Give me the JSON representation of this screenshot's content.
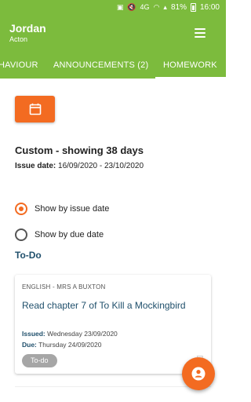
{
  "statusbar": {
    "battery": "81%",
    "time": "16:00",
    "net": "4G"
  },
  "appbar": {
    "title": "Jordan",
    "subtitle": "Acton"
  },
  "tabs": [
    {
      "label": "HAVIOUR"
    },
    {
      "label": "ANNOUNCEMENTS (2)"
    },
    {
      "label": "HOMEWORK",
      "active": true
    }
  ],
  "filter": {
    "range_title": "Custom - showing 38 days",
    "issue_label": "Issue date:",
    "issue_range": "16/09/2020 - 23/10/2020",
    "options": [
      {
        "label": "Show by issue date",
        "selected": true
      },
      {
        "label": "Show by due date",
        "selected": false
      }
    ]
  },
  "section": {
    "title": "To-Do"
  },
  "homework": [
    {
      "subject": "ENGLISH - MRS A BUXTON",
      "task": "Read chapter 7 of To Kill a Mockingbird",
      "issued_label": "Issued:",
      "issued": "Wednesday 23/09/2020",
      "due_label": "Due:",
      "due": "Thursday 24/09/2020",
      "status": "To-do"
    }
  ],
  "colors": {
    "brand": "#7cbb3d",
    "accent": "#f36b21",
    "heading": "#1f4f6b"
  },
  "icons": [
    "calendar-icon",
    "menu-icon",
    "person-icon"
  ]
}
